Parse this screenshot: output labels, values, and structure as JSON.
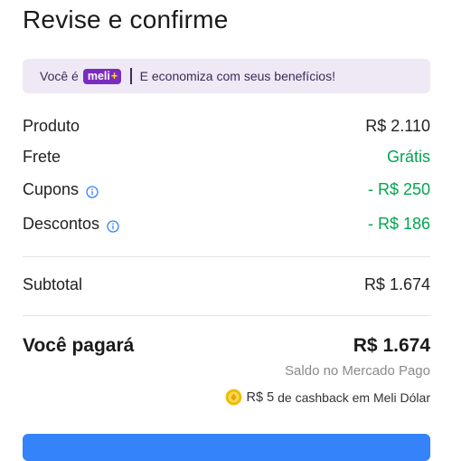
{
  "header": {
    "title": "Revise e confirme"
  },
  "meli_banner": {
    "prefix": "Você é",
    "badge_text": "meli",
    "badge_plus": "+",
    "message": "E economiza com seus benefícios!",
    "colors": {
      "background": "#efe9f5",
      "badge": "#7b2cbf",
      "plus": "#ffe600"
    }
  },
  "summary": {
    "produto": {
      "label": "Produto",
      "value": "R$ 2.110"
    },
    "frete": {
      "label": "Frete",
      "value": "Grátis"
    },
    "cupons": {
      "label": "Cupons",
      "value": "- R$ 250",
      "icon": "info-icon"
    },
    "descontos": {
      "label": "Descontos",
      "value": "- R$ 186",
      "icon": "info-icon"
    },
    "subtotal": {
      "label": "Subtotal",
      "value": "R$ 1.674"
    },
    "total": {
      "label": "Você pagará",
      "value": "R$ 1.674"
    },
    "payment_method": "Saldo no Mercado Pago",
    "cashback": {
      "amount": "R$ 5",
      "text": "de cashback em Meli Dólar",
      "icon": "meli-dolar-coin-icon"
    }
  },
  "colors": {
    "discount_green": "#00a650",
    "primary_blue": "#3483fa",
    "info_blue": "#3483fa"
  }
}
